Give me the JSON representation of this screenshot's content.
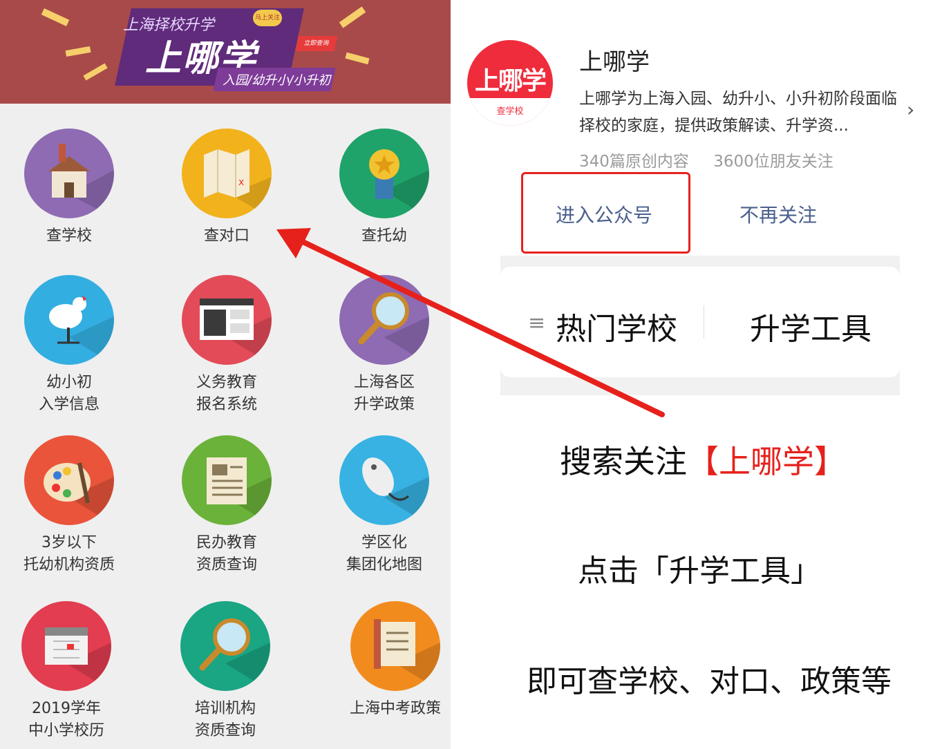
{
  "banner": {
    "title_small": "上海择校升学",
    "title_main": "上哪学",
    "subtitle": "入园/幼升小/小升初",
    "bubble_text": "马上关注",
    "tag_text": "立即查询"
  },
  "tiles": [
    {
      "label": "查学校",
      "icon": "school-house-icon",
      "color": "#8e6bb3"
    },
    {
      "label": "查对口",
      "icon": "map-icon",
      "color": "#f1b21c"
    },
    {
      "label": "查托幼",
      "icon": "award-ribbon-icon",
      "color": "#1fa36a"
    },
    {
      "label": "幼小初\n入学信息",
      "icon": "rooster-weathervane-icon",
      "color": "#33aee0"
    },
    {
      "label": "义务教育\n报名系统",
      "icon": "browser-window-icon",
      "color": "#e34b58"
    },
    {
      "label": "上海各区\n升学政策",
      "icon": "magnifier-icon",
      "color": "#8e6bb3"
    },
    {
      "label": "3岁以下\n托幼机构资质",
      "icon": "paint-palette-icon",
      "color": "#e9543a"
    },
    {
      "label": "民办教育\n资质查询",
      "icon": "newspaper-icon",
      "color": "#6bb23a"
    },
    {
      "label": "学区化\n集团化地图",
      "icon": "computer-mouse-icon",
      "color": "#37b2e2"
    },
    {
      "label": "2019学年\n中小学校历",
      "icon": "calendar-icon",
      "color": "#e23d50"
    },
    {
      "label": "培训机构\n资质查询",
      "icon": "magnifier-icon",
      "color": "#1aa583"
    },
    {
      "label": "上海中考政策",
      "icon": "certificate-scroll-icon",
      "color": "#f28b1e"
    }
  ],
  "account": {
    "logo_text": "上哪学",
    "logo_sub": "查学校",
    "name": "上哪学",
    "description": "上哪学为上海入园、幼升小、小升初阶段面临择校的家庭，提供政策解读、升学资...",
    "stats": [
      "340篇原创内容",
      "3600位朋友关注"
    ],
    "enter_button": "进入公众号",
    "unfollow_button": "不再关注"
  },
  "menu": {
    "hot_schools": "热门学校",
    "tools": "升学工具"
  },
  "notes": {
    "line1_prefix": "搜索关注",
    "line1_highlight": "【上哪学】",
    "line2": "点击「升学工具」",
    "line3": "即可查学校、对口、政策等"
  },
  "colors": {
    "accent_red": "#e6211c",
    "link_blue": "#4a5f8e",
    "banner_bg": "#a94a4a",
    "logo_red": "#ef2c3c"
  }
}
